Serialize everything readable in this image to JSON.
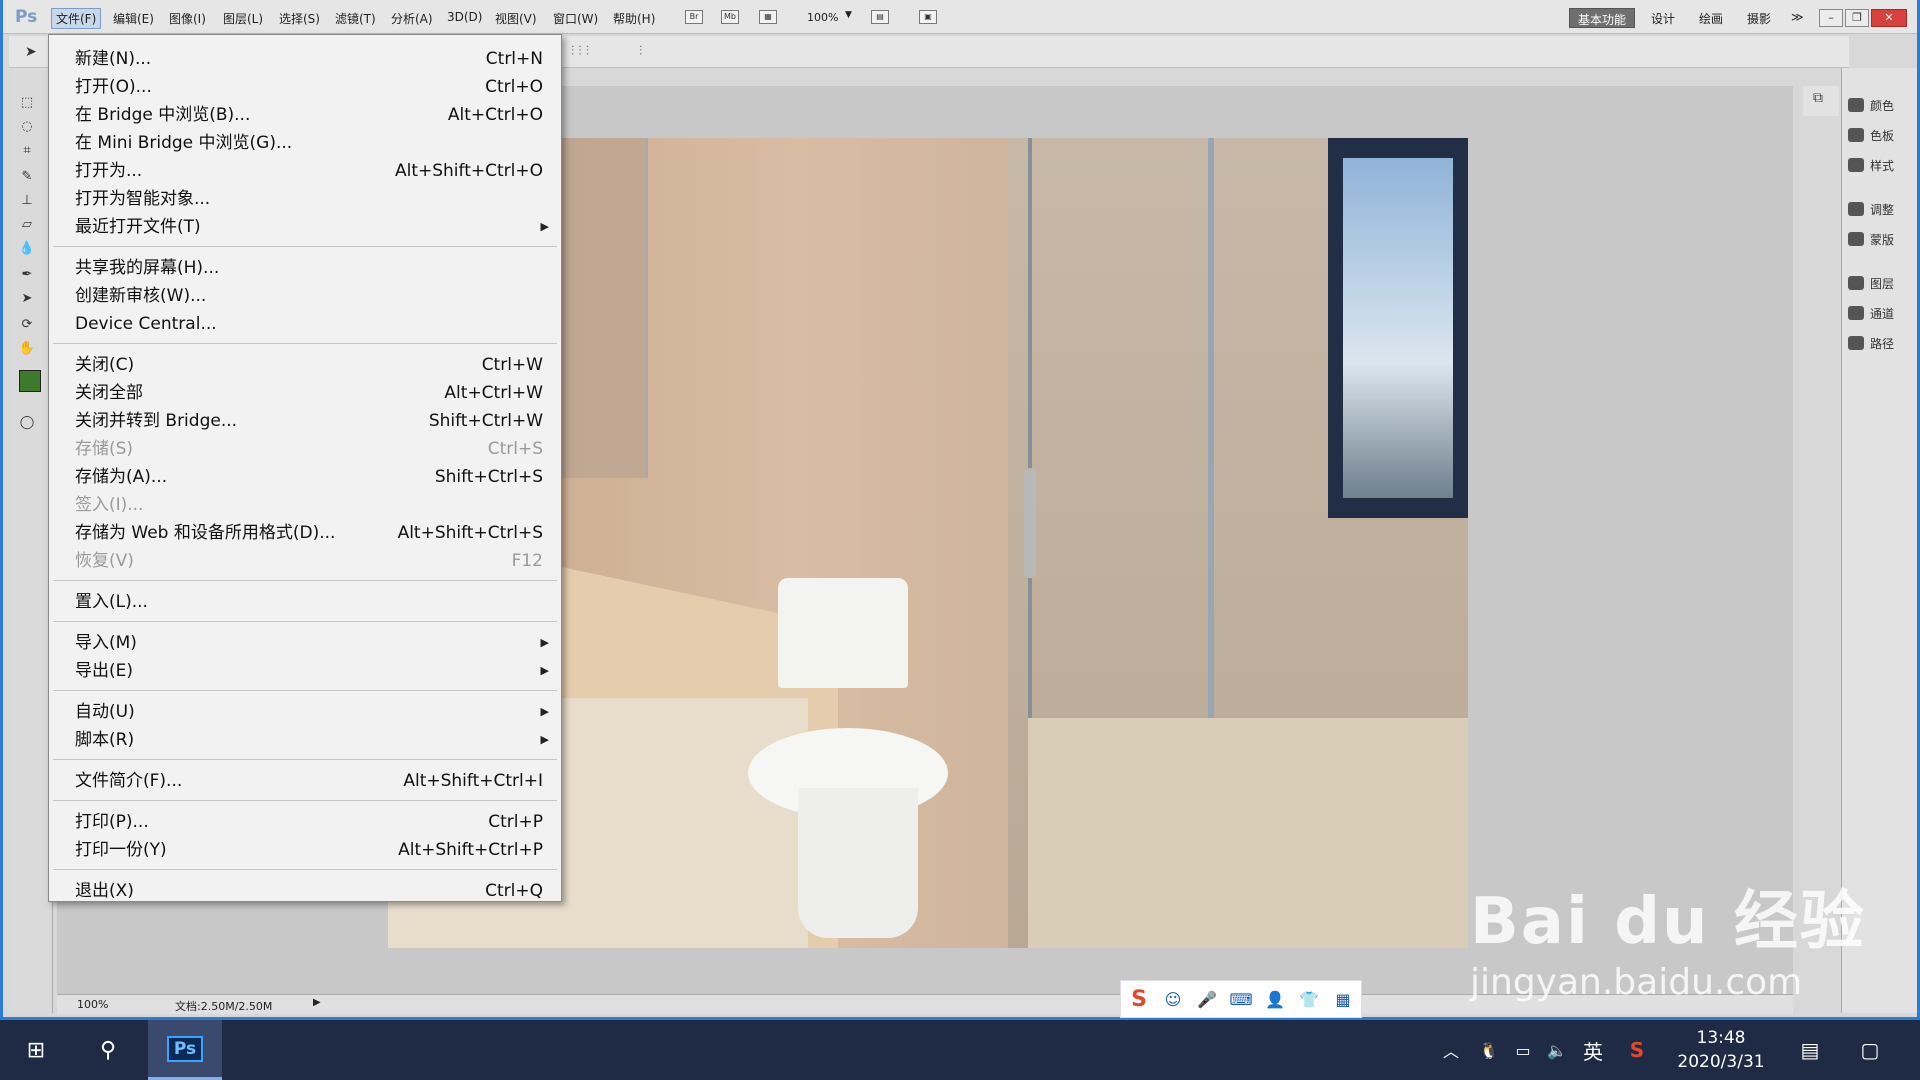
{
  "app": {
    "logo": "Ps"
  },
  "menubar": {
    "items": [
      "文件(F)",
      "编辑(E)",
      "图像(I)",
      "图层(L)",
      "选择(S)",
      "滤镜(T)",
      "分析(A)",
      "3D(D)",
      "视图(V)",
      "窗口(W)",
      "帮助(H)"
    ],
    "bridge_btn": "Br",
    "minibridge_btn": "Mb",
    "zoom": "100%",
    "workspaces": [
      "基本功能",
      "设计",
      "绘画",
      "摄影"
    ],
    "more": "≫"
  },
  "file_menu": {
    "groups": [
      [
        {
          "label": "新建(N)...",
          "shortcut": "Ctrl+N"
        },
        {
          "label": "打开(O)...",
          "shortcut": "Ctrl+O"
        },
        {
          "label": "在 Bridge 中浏览(B)...",
          "shortcut": "Alt+Ctrl+O"
        },
        {
          "label": "在 Mini Bridge 中浏览(G)...",
          "shortcut": ""
        },
        {
          "label": "打开为...",
          "shortcut": "Alt+Shift+Ctrl+O"
        },
        {
          "label": "打开为智能对象...",
          "shortcut": ""
        },
        {
          "label": "最近打开文件(T)",
          "shortcut": "",
          "submenu": true
        }
      ],
      [
        {
          "label": "共享我的屏幕(H)...",
          "shortcut": ""
        },
        {
          "label": "创建新审核(W)...",
          "shortcut": ""
        },
        {
          "label": "Device Central...",
          "shortcut": ""
        }
      ],
      [
        {
          "label": "关闭(C)",
          "shortcut": "Ctrl+W"
        },
        {
          "label": "关闭全部",
          "shortcut": "Alt+Ctrl+W"
        },
        {
          "label": "关闭并转到 Bridge...",
          "shortcut": "Shift+Ctrl+W"
        },
        {
          "label": "存储(S)",
          "shortcut": "Ctrl+S",
          "disabled": true
        },
        {
          "label": "存储为(A)...",
          "shortcut": "Shift+Ctrl+S"
        },
        {
          "label": "签入(I)...",
          "shortcut": "",
          "disabled": true
        },
        {
          "label": "存储为 Web 和设备所用格式(D)...",
          "shortcut": "Alt+Shift+Ctrl+S"
        },
        {
          "label": "恢复(V)",
          "shortcut": "F12",
          "disabled": true
        }
      ],
      [
        {
          "label": "置入(L)...",
          "shortcut": ""
        }
      ],
      [
        {
          "label": "导入(M)",
          "shortcut": "",
          "submenu": true
        },
        {
          "label": "导出(E)",
          "shortcut": "",
          "submenu": true
        }
      ],
      [
        {
          "label": "自动(U)",
          "shortcut": "",
          "submenu": true
        },
        {
          "label": "脚本(R)",
          "shortcut": "",
          "submenu": true
        }
      ],
      [
        {
          "label": "文件简介(F)...",
          "shortcut": "Alt+Shift+Ctrl+I"
        }
      ],
      [
        {
          "label": "打印(P)...",
          "shortcut": "Ctrl+P"
        },
        {
          "label": "打印一份(Y)",
          "shortcut": "Alt+Shift+Ctrl+P"
        }
      ],
      [
        {
          "label": "退出(X)",
          "shortcut": "Ctrl+Q"
        }
      ]
    ]
  },
  "right_panel": {
    "items": [
      "颜色",
      "色板",
      "样式",
      "调整",
      "蒙版",
      "图层",
      "通道",
      "路径"
    ]
  },
  "statusbar": {
    "zoom": "100%",
    "doc": "文档:2.50M/2.50M"
  },
  "taskbar": {
    "lang": "英",
    "time": "13:48",
    "date": "2020/3/31",
    "ps_label": "Ps"
  },
  "watermark": {
    "main": "Bai du 经验",
    "sub": "jingyan.baidu.com"
  },
  "colors": {
    "foreground": "#3f7a2a",
    "accent": "#2b7cd4",
    "taskbar": "#1f2a45"
  }
}
